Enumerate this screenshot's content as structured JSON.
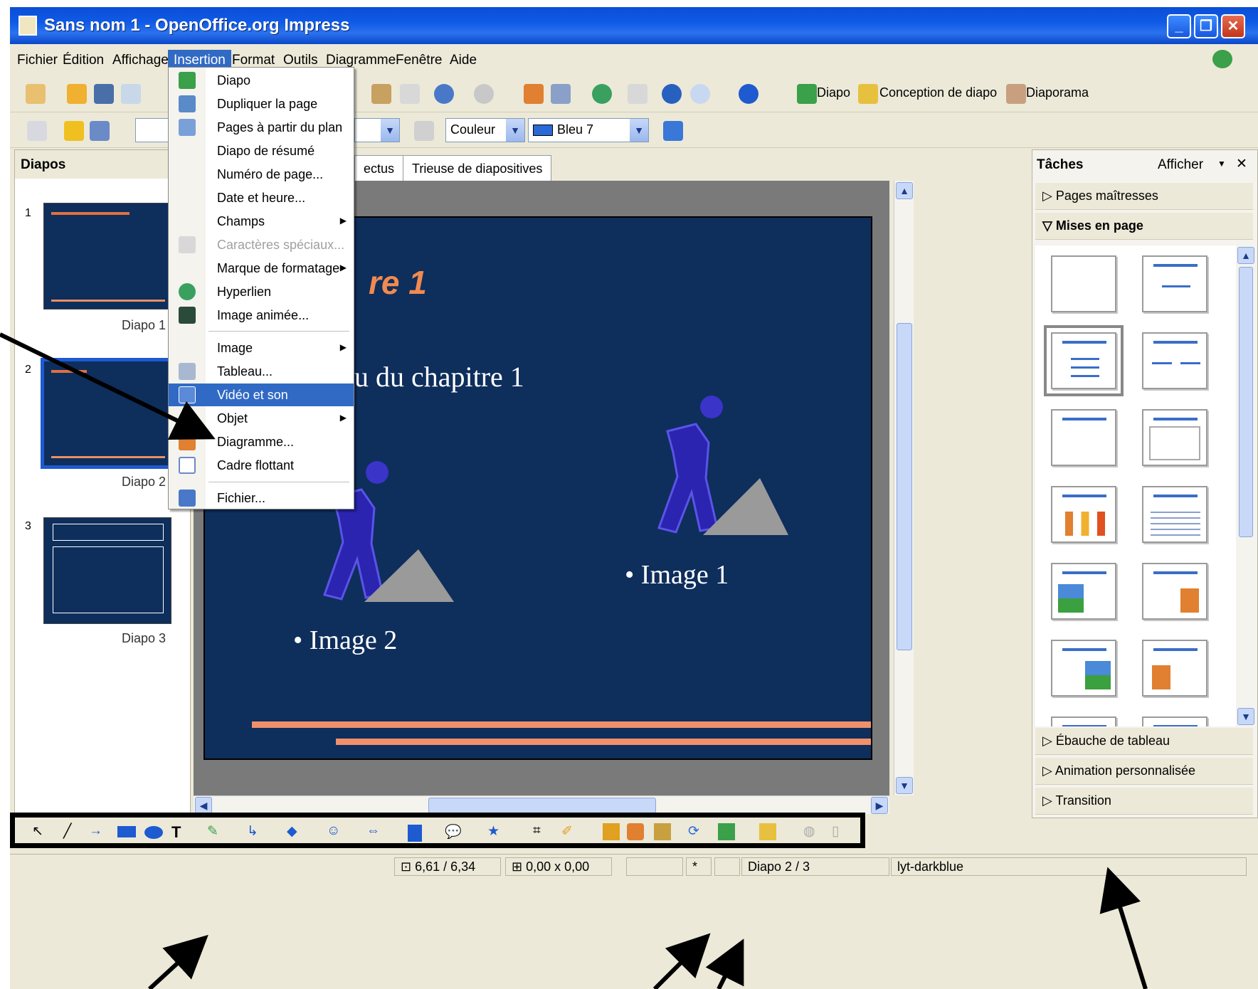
{
  "window": {
    "title": "Sans nom 1 - OpenOffice.org Impress",
    "controls": [
      "_",
      "❐",
      "✕"
    ]
  },
  "menubar": [
    "Fichier",
    "Édition",
    "Affichage",
    "Insertion",
    "Format",
    "Outils",
    "Diagramme",
    "Fenêtre",
    "Aide"
  ],
  "toolbar1": {
    "diapo_label": "Diapo",
    "conception_label": "Conception de diapo",
    "diaporama_label": "Diaporama"
  },
  "toolbar2": {
    "fill_type": "Couleur",
    "fill_color": "Bleu 7"
  },
  "insert_menu": [
    {
      "label": "Diapo",
      "icon": "slide-icon"
    },
    {
      "label": "Dupliquer la page",
      "icon": "duplicate-icon"
    },
    {
      "label": "Pages à partir du plan",
      "icon": "outline-pages-icon"
    },
    {
      "label": "Diapo de résumé"
    },
    {
      "label": "Numéro de page..."
    },
    {
      "label": "Date et heure..."
    },
    {
      "label": "Champs",
      "submenu": true
    },
    {
      "label": "Caractères spéciaux...",
      "disabled": true,
      "icon": "special-char-icon"
    },
    {
      "label": "Marque de formatage",
      "submenu": true
    },
    {
      "label": "Hyperlien",
      "icon": "hyperlink-icon"
    },
    {
      "label": "Image animée...",
      "icon": "animated-image-icon"
    },
    {
      "label": "Image",
      "submenu": true,
      "separator_before": true
    },
    {
      "label": "Tableau...",
      "icon": "table-icon"
    },
    {
      "label": "Vidéo et son",
      "icon": "video-sound-icon",
      "highlighted": true
    },
    {
      "label": "Objet",
      "submenu": true
    },
    {
      "label": "Diagramme...",
      "icon": "chart-icon"
    },
    {
      "label": "Cadre flottant",
      "icon": "floating-frame-icon"
    },
    {
      "label": "Fichier...",
      "icon": "file-icon",
      "separator_before": true
    }
  ],
  "slides_pane": {
    "title": "Diapos",
    "slides": [
      {
        "num": "1",
        "label": "Diapo 1"
      },
      {
        "num": "2",
        "label": "Diapo 2"
      },
      {
        "num": "3",
        "label": "Diapo 3"
      }
    ]
  },
  "tabs": [
    "ectus",
    "Trieuse de diapositives"
  ],
  "slide": {
    "title_fragment": "re 1",
    "subtitle_fragment": "u du chapitre 1",
    "caption_right": "• Image 1",
    "caption_left": "• Image 2"
  },
  "taskpane": {
    "title": "Tâches",
    "show_label": "Afficher",
    "sections": [
      "Pages maîtresses",
      "Mises en page",
      "Ébauche de tableau",
      "Animation personnalisée",
      "Transition"
    ]
  },
  "statusbar": {
    "position": "6,61 / 6,34",
    "size": "0,00 x 0,00",
    "star": "*",
    "slide": "Diapo 2 / 3",
    "layout": "lyt-darkblue"
  },
  "colors": {
    "slide_bg": "#0e2e5c",
    "accent_orange": "#f0906a",
    "menu_highlight": "#316ac5"
  }
}
